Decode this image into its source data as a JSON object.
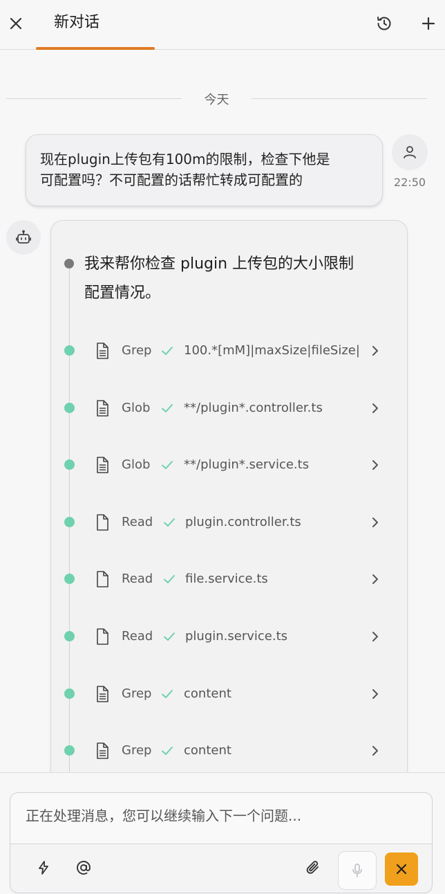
{
  "header": {
    "tab_label": "新对话"
  },
  "divider": {
    "date_label": "今天"
  },
  "user_message": {
    "text_line1": "现在plugin上传包有100m的限制，检查下他是",
    "text_line2": "可配置吗？不可配置的话帮忙转成可配置的",
    "time": "22:50"
  },
  "assistant": {
    "text_line1": "我来帮你检查 plugin 上传包的大小限制",
    "text_line2": "配置情况。",
    "steps": [
      {
        "tool": "Grep",
        "arg": "100.*[mM]|maxSize|fileSize|…",
        "icon": "file-text-icon"
      },
      {
        "tool": "Glob",
        "arg": "**/plugin*.controller.ts",
        "icon": "file-text-icon"
      },
      {
        "tool": "Glob",
        "arg": "**/plugin*.service.ts",
        "icon": "file-text-icon"
      },
      {
        "tool": "Read",
        "arg": "plugin.controller.ts",
        "icon": "file-icon"
      },
      {
        "tool": "Read",
        "arg": "file.service.ts",
        "icon": "file-icon"
      },
      {
        "tool": "Read",
        "arg": "plugin.service.ts",
        "icon": "file-icon"
      },
      {
        "tool": "Grep",
        "arg": "content",
        "icon": "file-text-icon"
      },
      {
        "tool": "Grep",
        "arg": "content",
        "icon": "file-text-icon"
      }
    ]
  },
  "composer": {
    "placeholder": "正在处理消息，您可以继续输入下一个问题..."
  },
  "colors": {
    "accent": "#e07b22",
    "success_dot": "#6fd1ad",
    "stop_button": "#f0a01c"
  }
}
